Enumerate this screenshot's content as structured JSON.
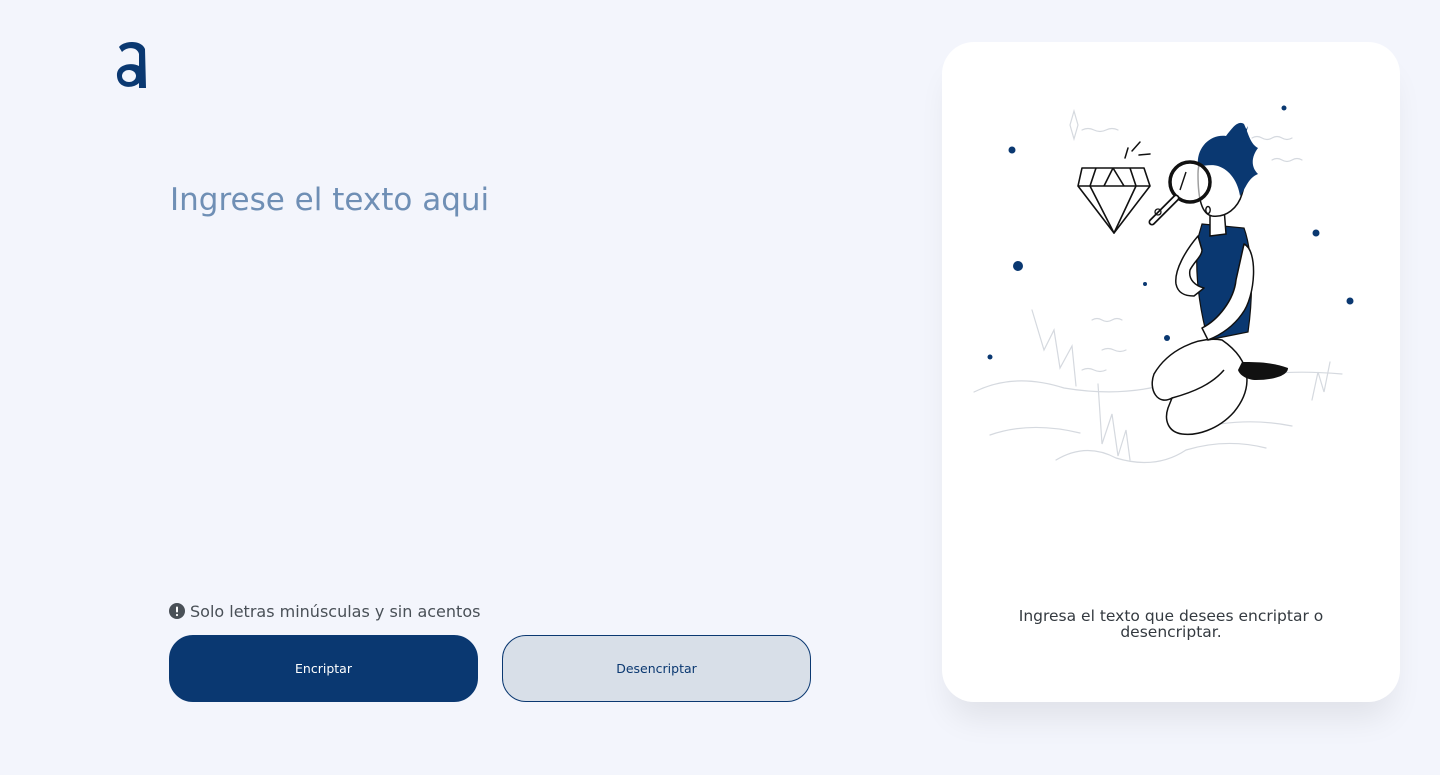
{
  "app": {
    "logo_icon": "alura-a-logo-icon",
    "accent_color": "#0a3871",
    "background_color": "#f3f5fc"
  },
  "editor": {
    "placeholder": "Ingrese el texto aqui",
    "value": ""
  },
  "hint": {
    "icon": "exclamation-circle-icon",
    "text": "Solo letras minúsculas y sin acentos"
  },
  "actions": {
    "encrypt_label": "Encriptar",
    "decrypt_label": "Desencriptar"
  },
  "output_panel": {
    "illustration": "person-with-magnifying-glass-and-diamond-illustration",
    "message": "Ingresa el texto que desees encriptar o desencriptar."
  }
}
